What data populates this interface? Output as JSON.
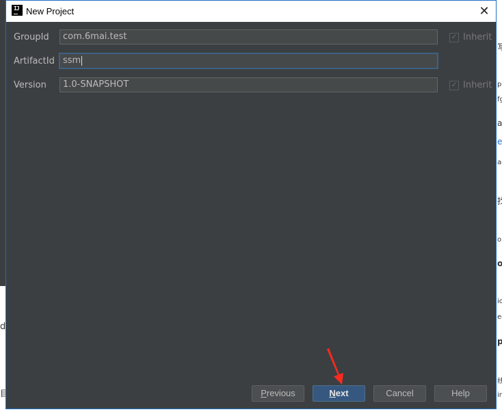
{
  "dialog": {
    "title": "New Project",
    "close_symbol": "✕"
  },
  "fields": [
    {
      "label": "GroupId",
      "value": "com.6mai.test",
      "inherit_label": "Inherit",
      "has_inherit": true
    },
    {
      "label": "ArtifactId",
      "value": "ssm",
      "inherit_label": "",
      "has_inherit": false
    },
    {
      "label": "Version",
      "value": "1.0-SNAPSHOT",
      "inherit_label": "Inherit",
      "has_inherit": true
    }
  ],
  "buttons": {
    "previous": {
      "mnemonic": "P",
      "rest": "revious"
    },
    "next": {
      "mnemonic": "N",
      "rest": "ext"
    },
    "cancel": "Cancel",
    "help": "Help"
  },
  "background_fragments": [
    "写",
    "pe",
    "fg",
    "a",
    "e",
    "ac",
    "找",
    "or",
    "ou",
    "io",
    "ec",
    "pi",
    "d",
    "目",
    "线",
    "ir"
  ],
  "colors": {
    "dialog_bg": "#3c3f41",
    "accent_border": "#1e6fc0",
    "primary_button": "#365880",
    "annotation_arrow": "#ff2a1f"
  }
}
